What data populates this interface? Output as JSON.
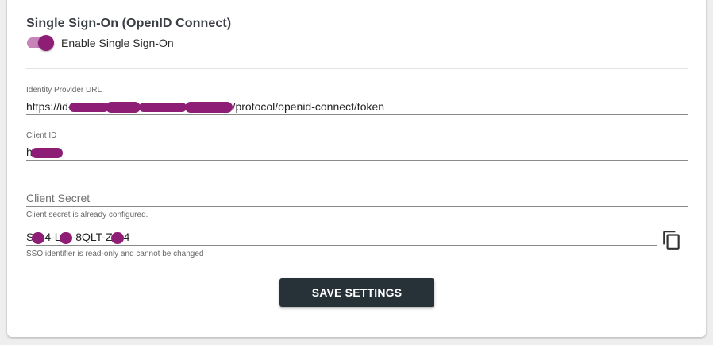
{
  "section": {
    "title": "Single Sign-On (OpenID Connect)",
    "toggle": {
      "label": "Enable Single Sign-On",
      "checked": true,
      "accent_color": "#8e1d75"
    }
  },
  "fields": {
    "identity_provider_url": {
      "label": "Identity Provider URL",
      "value_prefix": "https://id-",
      "value_suffix": "/protocol/openid-connect/token"
    },
    "client_id": {
      "label": "Client ID",
      "value_prefix": "h"
    },
    "client_secret": {
      "placeholder": "Client Secret",
      "hint": "Client secret is already configured."
    },
    "sso_identifier": {
      "value_parts": [
        "S",
        "4-L",
        "-8QLT-Z",
        "4"
      ],
      "hint": "SSO identifier is read-only and cannot be changed",
      "copy_icon": "copy-icon"
    }
  },
  "actions": {
    "save_label": "SAVE SETTINGS"
  },
  "colors": {
    "button_bg": "#263138",
    "redaction": "#8e1d75"
  }
}
